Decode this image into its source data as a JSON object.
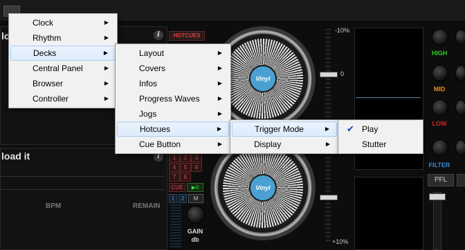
{
  "deck_a": {
    "title": "load",
    "hotcues_label": "HOTCUES"
  },
  "deck_b": {
    "title": "load it",
    "hotcues": [
      "1",
      "2",
      "3",
      "4",
      "5",
      "6",
      "7",
      "8"
    ],
    "cue_label": "CUE",
    "play_label": "▶II",
    "mode_buttons": [
      "1",
      "2",
      "M"
    ],
    "bpm_label": "BPM",
    "remain_label": "REMAIN"
  },
  "gain_label": "GAIN",
  "gain_unit": "db",
  "jog_label": "Vinyl",
  "pitch": {
    "minus": "-10%",
    "zero": "0",
    "plus": "+10%"
  },
  "eq": {
    "high": "HIGH",
    "mid": "MID",
    "low": "LOW",
    "filter": "FILTER"
  },
  "pfl_label": "PFL",
  "menu_main": [
    "Clock",
    "Rhythm",
    "Decks",
    "Central Panel",
    "Browser",
    "Controller"
  ],
  "menu_decks": [
    "Layout",
    "Covers",
    "Infos",
    "Progress Waves",
    "Jogs",
    "Hotcues",
    "Cue Button"
  ],
  "menu_hotcues": [
    "Trigger Mode",
    "Display"
  ],
  "menu_trigger": [
    "Play",
    "Stutter"
  ],
  "checked": "Play",
  "colors": {
    "high": "#2fcf2f",
    "mid": "#e8901a",
    "low": "#e02020",
    "filter": "#3a8ad8",
    "hotcue_red": "#d04a4a",
    "jog_blue": "#4aa0d0"
  }
}
